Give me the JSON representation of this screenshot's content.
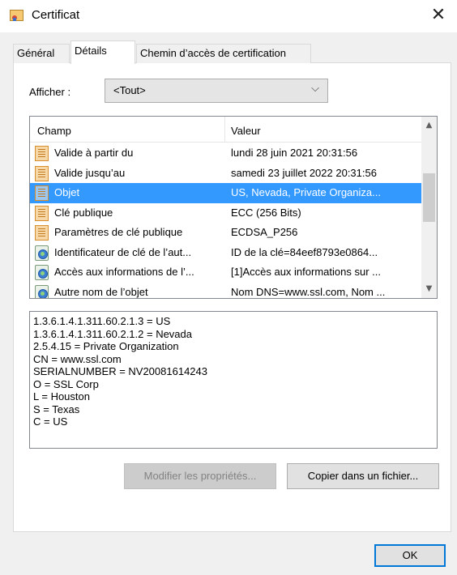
{
  "window": {
    "title": "Certificat",
    "close_glyph": "✕"
  },
  "tabs": [
    {
      "label": "Général",
      "active": false
    },
    {
      "label": "Détails",
      "active": true
    },
    {
      "label": "Chemin d’accès de certification",
      "active": false
    }
  ],
  "show": {
    "label": "Afficher :",
    "selected": "<Tout>",
    "chevron": "⌵"
  },
  "fields_list": {
    "col_field": "Champ",
    "col_value": "Valeur",
    "rows": [
      {
        "field": "Valide à partir du",
        "value": "lundi 28 juin 2021 20:31:56",
        "icon": "certificate-icon",
        "selected": false
      },
      {
        "field": "Valide jusqu’au",
        "value": "samedi 23 juillet 2022 20:31:56",
        "icon": "certificate-icon",
        "selected": false
      },
      {
        "field": "Objet",
        "value": "US, Nevada, Private Organiza...",
        "icon": "certificate-icon",
        "selected": true
      },
      {
        "field": "Clé publique",
        "value": "ECC (256 Bits)",
        "icon": "certificate-icon",
        "selected": false
      },
      {
        "field": "Paramètres de clé publique",
        "value": "ECDSA_P256",
        "icon": "certificate-icon",
        "selected": false
      },
      {
        "field": "Identificateur de clé de l’aut...",
        "value": "ID de la clé=84eef8793e0864...",
        "icon": "extension-icon",
        "selected": false
      },
      {
        "field": "Accès aux informations de l’...",
        "value": "[1]Accès aux informations sur ...",
        "icon": "extension-icon",
        "selected": false
      },
      {
        "field": "Autre nom de l’objet",
        "value": "Nom DNS=www.ssl.com, Nom ...",
        "icon": "extension-icon",
        "selected": false
      }
    ]
  },
  "detail_lines": [
    "1.3.6.1.4.1.311.60.2.1.3 = US",
    "1.3.6.1.4.1.311.60.2.1.2 = Nevada",
    "2.5.4.15 = Private Organization",
    "CN = www.ssl.com",
    "SERIALNUMBER = NV20081614243",
    "O = SSL Corp",
    "L = Houston",
    "S = Texas",
    "C = US"
  ],
  "buttons": {
    "edit_properties": "Modifier les propriétés...",
    "copy_to_file": "Copier dans un fichier...",
    "ok": "OK"
  },
  "colors": {
    "selection": "#3399ff",
    "accent_border": "#0078d7"
  }
}
